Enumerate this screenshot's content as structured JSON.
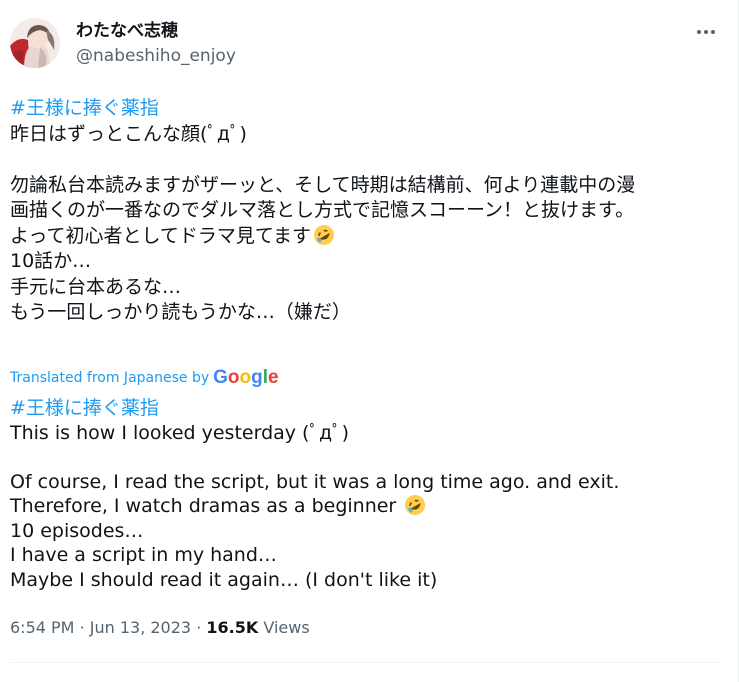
{
  "user": {
    "display_name": "わたなべ志穂",
    "handle": "@nabeshiho_enjoy",
    "avatar_icon": "avatar-illustration"
  },
  "menu": {
    "icon": "more-options-icon"
  },
  "tweet": {
    "original": {
      "hashtag": "#王様に捧ぐ薬指",
      "lines": [
        "昨日はずっとこんな顔(ﾟдﾟ)",
        "",
        "勿論私台本読みますがザーッと、そして時期は結構前、何より連載中の漫",
        "画描くのが一番なのでダルマ落とし方式で記憶スコーーン！と抜けます。",
        "よって初心者としてドラマ見てます",
        "10話か…",
        "手元に台本あるな…",
        "もう一回しっかり読もうかな…（嫌だ）"
      ],
      "emoji": "rolling-on-floor-laughing-emoji"
    },
    "translation": {
      "label": "Translated from Japanese by",
      "provider": "Google",
      "hashtag": "#王様に捧ぐ薬指",
      "lines": [
        "This is how I looked yesterday (ﾟдﾟ)",
        "",
        "Of course, I read the script, but it was a long time ago. and exit.",
        "Therefore, I watch dramas as a beginner",
        "10 episodes…",
        "I have a script in my hand…",
        "Maybe I should read it again… (I don't like it)"
      ]
    }
  },
  "meta": {
    "time": "6:54 PM",
    "separator": "·",
    "date": "Jun 13, 2023",
    "views_count": "16.5K",
    "views_label": "Views"
  },
  "colors": {
    "link": "#1d9bf0",
    "text": "#0f1419",
    "secondary": "#536471",
    "google_blue": "#4285F4",
    "google_red": "#EA4335",
    "google_yellow": "#FBBC05",
    "google_green": "#34A853"
  }
}
